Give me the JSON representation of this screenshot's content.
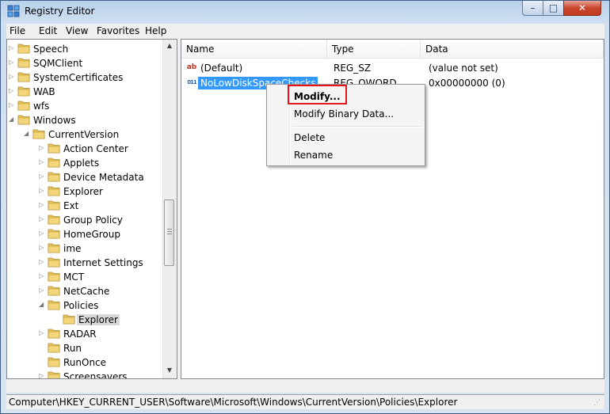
{
  "window": {
    "title": "Registry Editor",
    "controls": {
      "minimize": "–",
      "maximize": "□",
      "close": "✕"
    }
  },
  "menubar": {
    "items": [
      "File",
      "Edit",
      "View",
      "Favorites",
      "Help"
    ]
  },
  "tree": {
    "items": [
      {
        "label": "Speech",
        "expander": "collapsed"
      },
      {
        "label": "SQMClient",
        "expander": "collapsed"
      },
      {
        "label": "SystemCertificates",
        "expander": "collapsed"
      },
      {
        "label": "WAB",
        "expander": "collapsed"
      },
      {
        "label": "wfs",
        "expander": "collapsed"
      },
      {
        "label": "Windows",
        "expander": "expanded"
      },
      {
        "label": "CurrentVersion",
        "expander": "expanded"
      },
      {
        "label": "Action Center",
        "expander": "collapsed"
      },
      {
        "label": "Applets",
        "expander": "collapsed"
      },
      {
        "label": "Device Metadata",
        "expander": "collapsed"
      },
      {
        "label": "Explorer",
        "expander": "collapsed"
      },
      {
        "label": "Ext",
        "expander": "collapsed"
      },
      {
        "label": "Group Policy",
        "expander": "collapsed"
      },
      {
        "label": "HomeGroup",
        "expander": "collapsed"
      },
      {
        "label": "ime",
        "expander": "collapsed"
      },
      {
        "label": "Internet Settings",
        "expander": "collapsed"
      },
      {
        "label": "MCT",
        "expander": "collapsed"
      },
      {
        "label": "NetCache",
        "expander": "collapsed"
      },
      {
        "label": "Policies",
        "expander": "expanded"
      },
      {
        "label": "Explorer",
        "expander": "none",
        "selected": true
      },
      {
        "label": "RADAR",
        "expander": "collapsed"
      },
      {
        "label": "Run",
        "expander": "none"
      },
      {
        "label": "RunOnce",
        "expander": "none"
      },
      {
        "label": "Screensavers",
        "expander": "collapsed"
      }
    ]
  },
  "list": {
    "columns": [
      "Name",
      "Type",
      "Data"
    ],
    "rows": [
      {
        "name": "(Default)",
        "type": "REG_SZ",
        "data": "(value not set)",
        "icon": "string-value-icon",
        "icon_text": "ab"
      },
      {
        "name": "NoLowDiskSpaceChecks",
        "type": "REG_QWORD",
        "data": "0x00000000 (0)",
        "icon": "binary-value-icon",
        "icon_text": "011",
        "selected": true
      }
    ]
  },
  "context_menu": {
    "modify": "Modify...",
    "modify_binary": "Modify Binary Data...",
    "delete": "Delete",
    "rename": "Rename"
  },
  "status": {
    "path": "Computer\\HKEY_CURRENT_USER\\Software\\Microsoft\\Windows\\CurrentVersion\\Policies\\Explorer"
  },
  "colors": {
    "selection": "#3399ff",
    "highlight_box": "#e8141b",
    "folder": "#e8c45a"
  }
}
